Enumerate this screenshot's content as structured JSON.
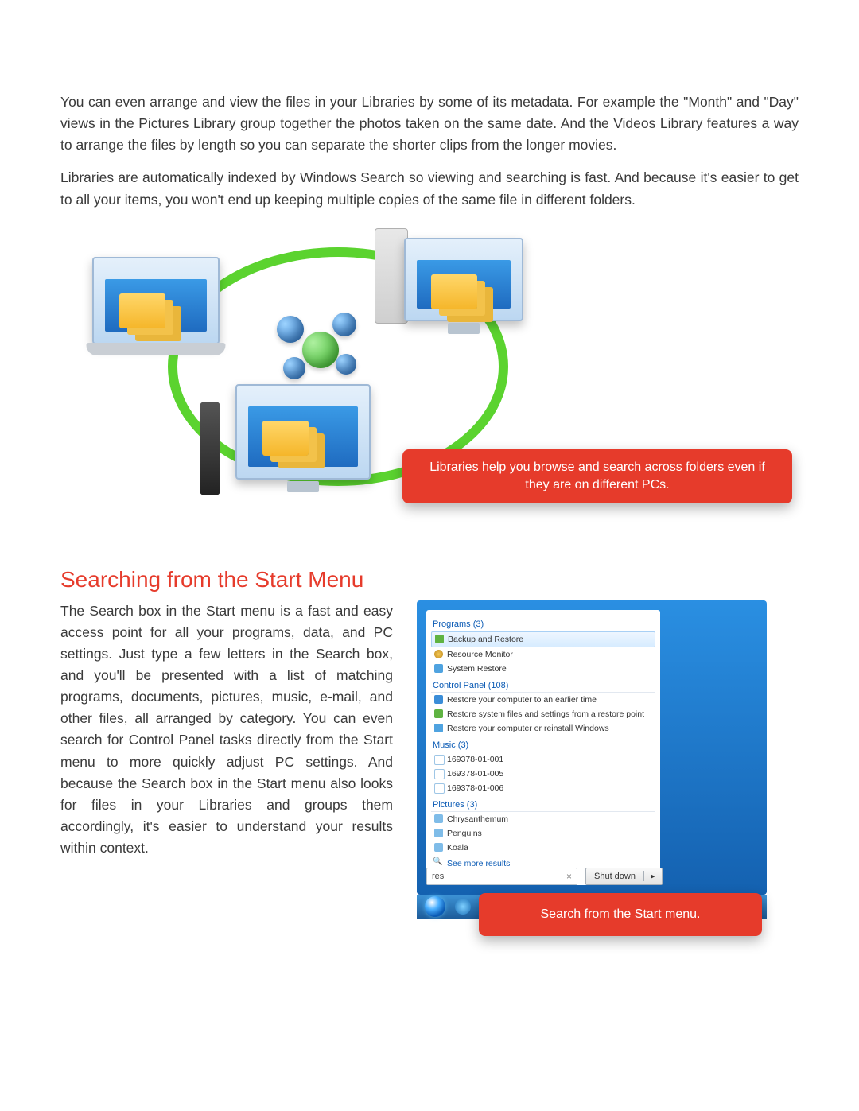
{
  "paragraphs": {
    "p1": "You can even arrange and view the files in your Libraries by some of its metadata. For example the \"Month\" and \"Day\" views in the Pictures Library group together the photos taken on the same date. And the Videos Library features a way to arrange the files by length so you can separate the shorter clips from the longer movies.",
    "p2": "Libraries are automatically indexed by Windows Search so viewing and searching is fast. And because it's easier to get to all your items, you won't end up keeping multiple copies of the same file in different folders."
  },
  "figure_callout": "Libraries help you browse and search across folders even if they are on different PCs.",
  "section_title": "Searching from the Start Menu",
  "section_body": "The Search box in the Start menu is a fast and easy access point for all your programs, data, and PC settings. Just type a few letters in the Search box, and you'll be presented with a list of matching programs, documents, pictures, music, e-mail, and other files, all arranged by category. You can even search for Control Panel tasks directly from the Start menu to more quickly adjust PC settings. And because the Search box in the Start menu also looks for files in your Libraries and groups them accordingly, it's easier to understand your results within context.",
  "startmenu": {
    "categories": [
      {
        "label": "Programs (3)",
        "items": [
          {
            "text": "Backup and Restore",
            "icon": "ico-prog",
            "selected": true
          },
          {
            "text": "Resource Monitor",
            "icon": "ico-mon"
          },
          {
            "text": "System Restore",
            "icon": "ico-sys"
          }
        ]
      },
      {
        "label": "Control Panel (108)",
        "items": [
          {
            "text": "Restore your computer to an earlier time",
            "icon": "ico-cp1"
          },
          {
            "text": "Restore system files and settings from a restore point",
            "icon": "ico-cp2"
          },
          {
            "text": "Restore your computer or reinstall Windows",
            "icon": "ico-cp3"
          }
        ]
      },
      {
        "label": "Music (3)",
        "items": [
          {
            "text": "169378-01-001",
            "icon": "ico-music"
          },
          {
            "text": "169378-01-005",
            "icon": "ico-music"
          },
          {
            "text": "169378-01-006",
            "icon": "ico-music"
          }
        ]
      },
      {
        "label": "Pictures (3)",
        "items": [
          {
            "text": "Chrysanthemum",
            "icon": "ico-pic"
          },
          {
            "text": "Penguins",
            "icon": "ico-pic"
          },
          {
            "text": "Koala",
            "icon": "ico-pic"
          }
        ]
      }
    ],
    "more": "See more results",
    "search_value": "res",
    "shutdown": "Shut down",
    "shutdown_arrow": "▸"
  },
  "startmenu_callout": "Search from the Start menu."
}
